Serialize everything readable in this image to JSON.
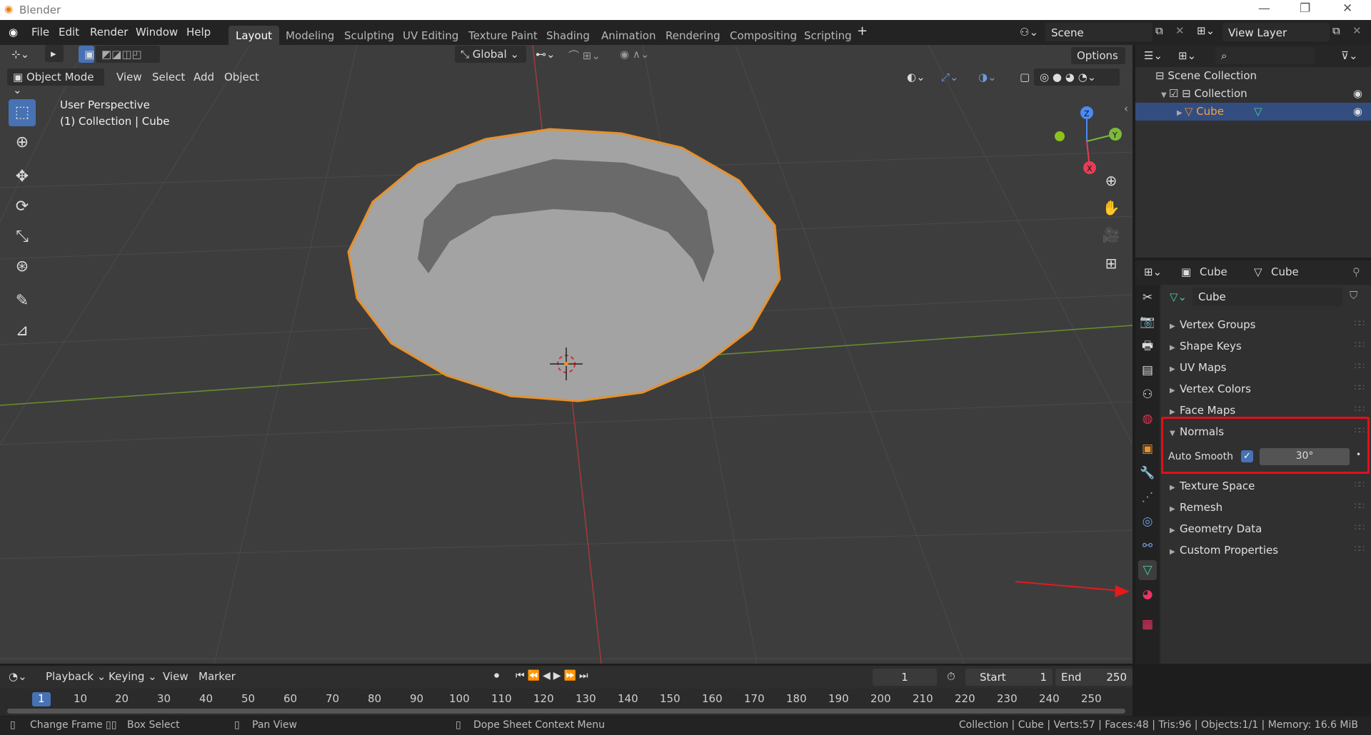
{
  "app": {
    "title": "Blender"
  },
  "menu": {
    "items": [
      "File",
      "Edit",
      "Render",
      "Window",
      "Help"
    ]
  },
  "workspaces": [
    "Layout",
    "Modeling",
    "Sculpting",
    "UV Editing",
    "Texture Paint",
    "Shading",
    "Animation",
    "Rendering",
    "Compositing",
    "Scripting"
  ],
  "active_workspace": "Layout",
  "scene": {
    "name": "Scene"
  },
  "view_layer": {
    "name": "View Layer"
  },
  "viewport": {
    "mode": "Object Mode",
    "menus": [
      "View",
      "Select",
      "Add",
      "Object"
    ],
    "transform_orientation": "Global",
    "options_label": "Options",
    "overlay_line1": "User Perspective",
    "overlay_line2": "(1) Collection | Cube",
    "axes": {
      "z": "Z",
      "y": "Y",
      "x": "X"
    }
  },
  "outliner": {
    "rows": [
      {
        "label": "Scene Collection"
      },
      {
        "label": "Collection"
      },
      {
        "label": "Cube"
      }
    ]
  },
  "properties": {
    "header_object": "Cube",
    "header_data": "Cube",
    "mesh_name": "Cube",
    "panels": [
      {
        "label": "Vertex Groups",
        "open": false
      },
      {
        "label": "Shape Keys",
        "open": false
      },
      {
        "label": "UV Maps",
        "open": false
      },
      {
        "label": "Vertex Colors",
        "open": false
      },
      {
        "label": "Face Maps",
        "open": false
      },
      {
        "label": "Normals",
        "open": true
      },
      {
        "label": "Texture Space",
        "open": false
      },
      {
        "label": "Remesh",
        "open": false
      },
      {
        "label": "Geometry Data",
        "open": false
      },
      {
        "label": "Custom Properties",
        "open": false
      }
    ],
    "auto_smooth": {
      "label": "Auto Smooth",
      "checked": true,
      "angle": "30°"
    },
    "highlight_color": "#e0101a"
  },
  "timeline": {
    "menus": [
      "Playback",
      "Keying",
      "View",
      "Marker"
    ],
    "current_frame": "1",
    "start_label": "Start",
    "start_value": "1",
    "end_label": "End",
    "end_value": "250",
    "ruler": [
      "1",
      "10",
      "20",
      "30",
      "40",
      "50",
      "60",
      "70",
      "80",
      "90",
      "100",
      "110",
      "120",
      "130",
      "140",
      "150",
      "160",
      "170",
      "180",
      "190",
      "200",
      "210",
      "220",
      "230",
      "240",
      "250"
    ]
  },
  "statusbar": {
    "left": [
      "Change Frame",
      "Box Select",
      "Pan View",
      "Dope Sheet Context Menu"
    ],
    "right": "Collection | Cube | Verts:57 | Faces:48 | Tris:96 | Objects:1/1 | Memory: 16.6 MiB"
  },
  "colors": {
    "accent": "#4772b3",
    "selection": "#e8902a",
    "highlight": "#e0101a"
  }
}
